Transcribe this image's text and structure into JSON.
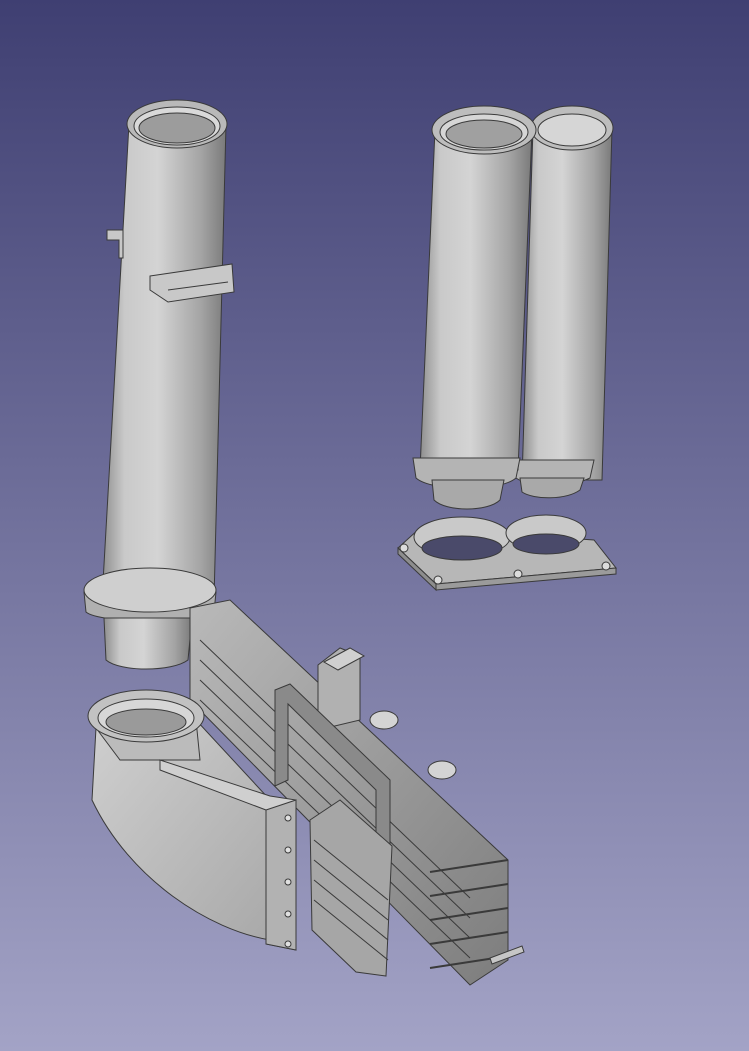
{
  "viewer": {
    "background_top": "#3f3f72",
    "background_bottom": "#a3a3c6",
    "part_color": "#c4c4c4",
    "edge_color": "#3a3a3a"
  },
  "scene": {
    "parts": [
      {
        "name": "single-intake-tube",
        "icon": "tube-icon"
      },
      {
        "name": "twin-intake-tube-left",
        "icon": "tube-icon"
      },
      {
        "name": "twin-intake-tube-right",
        "icon": "tube-icon"
      },
      {
        "name": "twin-tube-mounting-plate",
        "icon": "plate-icon"
      },
      {
        "name": "elbow-duct",
        "icon": "elbow-icon"
      },
      {
        "name": "heatsink-assembly",
        "icon": "heatsink-icon"
      },
      {
        "name": "side-panel",
        "icon": "panel-icon"
      }
    ]
  }
}
